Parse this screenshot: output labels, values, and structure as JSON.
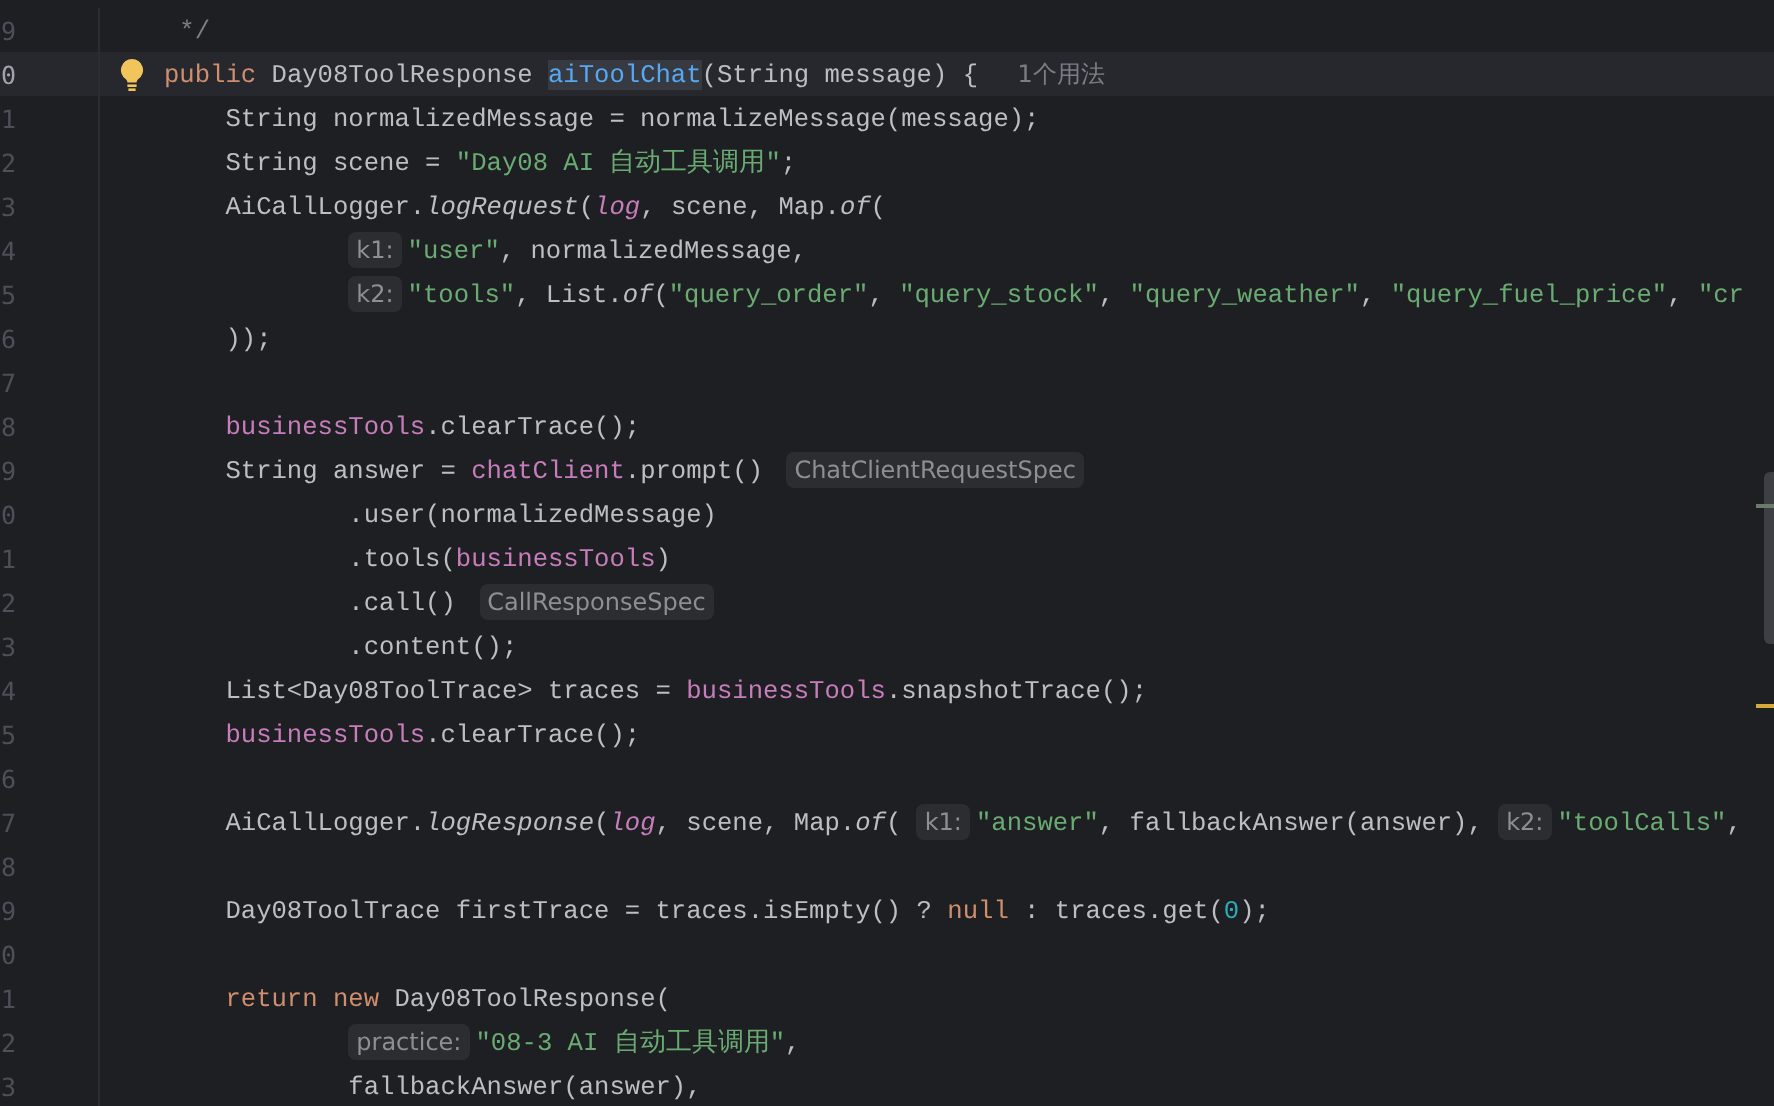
{
  "editor": {
    "lines": [
      {
        "number": "9",
        "current": false,
        "kind": "comment",
        "segments": [
          {
            "kind": "code",
            "tokens": [
              {
                "kind": "comment",
                "text": "*/"
              }
            ]
          }
        ]
      },
      {
        "number": "0",
        "current": true,
        "kind": "top",
        "segments": [
          {
            "kind": "code",
            "tokens": [
              {
                "kind": "kw",
                "text": "public "
              },
              {
                "kind": "plain",
                "text": "Day08ToolResponse "
              },
              {
                "kind": "decl",
                "text": "aiToolChat"
              },
              {
                "kind": "plain",
                "text": "(String message) {"
              }
            ]
          },
          {
            "kind": "usage",
            "text": "1个用法"
          }
        ]
      },
      {
        "number": "1",
        "current": false,
        "kind": "body",
        "segments": [
          {
            "kind": "code",
            "tokens": [
              {
                "kind": "plain",
                "text": "String normalizedMessage = normalizeMessage(message);"
              }
            ]
          }
        ]
      },
      {
        "number": "2",
        "current": false,
        "kind": "body",
        "segments": [
          {
            "kind": "code",
            "tokens": [
              {
                "kind": "plain",
                "text": "String scene = "
              },
              {
                "kind": "str",
                "text": "\"Day08 AI 自动工具调用\""
              },
              {
                "kind": "plain",
                "text": ";"
              }
            ]
          }
        ]
      },
      {
        "number": "3",
        "current": false,
        "kind": "body",
        "segments": [
          {
            "kind": "code",
            "tokens": [
              {
                "kind": "plain",
                "text": "AiCallLogger."
              },
              {
                "kind": "static",
                "text": "logRequest"
              },
              {
                "kind": "plain",
                "text": "("
              },
              {
                "kind": "static_field",
                "text": "log"
              },
              {
                "kind": "plain",
                "text": ", scene, Map."
              },
              {
                "kind": "static",
                "text": "of"
              },
              {
                "kind": "plain",
                "text": "("
              }
            ]
          }
        ]
      },
      {
        "number": "4",
        "current": false,
        "kind": "continuation",
        "segments": [
          {
            "kind": "hint",
            "text": "k1:"
          },
          {
            "kind": "code",
            "tokens": [
              {
                "kind": "str",
                "text": "\"user\""
              },
              {
                "kind": "plain",
                "text": ", normalizedMessage,"
              }
            ]
          }
        ]
      },
      {
        "number": "5",
        "current": false,
        "kind": "continuation",
        "segments": [
          {
            "kind": "hint",
            "text": "k2:"
          },
          {
            "kind": "code",
            "tokens": [
              {
                "kind": "str",
                "text": "\"tools\""
              },
              {
                "kind": "plain",
                "text": ", List."
              },
              {
                "kind": "static",
                "text": "of"
              },
              {
                "kind": "plain",
                "text": "("
              },
              {
                "kind": "str",
                "text": "\"query_order\""
              },
              {
                "kind": "plain",
                "text": ", "
              },
              {
                "kind": "str",
                "text": "\"query_stock\""
              },
              {
                "kind": "plain",
                "text": ", "
              },
              {
                "kind": "str",
                "text": "\"query_weather\""
              },
              {
                "kind": "plain",
                "text": ", "
              },
              {
                "kind": "str",
                "text": "\"query_fuel_price\""
              },
              {
                "kind": "plain",
                "text": ", "
              },
              {
                "kind": "str",
                "text": "\"cr"
              }
            ]
          }
        ]
      },
      {
        "number": "6",
        "current": false,
        "kind": "body",
        "segments": [
          {
            "kind": "code",
            "tokens": [
              {
                "kind": "plain",
                "text": "));"
              }
            ]
          }
        ]
      },
      {
        "number": "7",
        "current": false,
        "kind": "body"
      },
      {
        "number": "8",
        "current": false,
        "kind": "body",
        "segments": [
          {
            "kind": "code",
            "tokens": [
              {
                "kind": "field",
                "text": "businessTools"
              },
              {
                "kind": "plain",
                "text": ".clearTrace();"
              }
            ]
          }
        ]
      },
      {
        "number": "9",
        "current": false,
        "kind": "body",
        "segments": [
          {
            "kind": "code",
            "tokens": [
              {
                "kind": "plain",
                "text": "String answer = "
              },
              {
                "kind": "field",
                "text": "chatClient"
              },
              {
                "kind": "plain",
                "text": ".prompt()"
              }
            ]
          },
          {
            "kind": "type_hint",
            "text": "ChatClientRequestSpec"
          }
        ]
      },
      {
        "number": "0",
        "current": false,
        "kind": "continuation",
        "segments": [
          {
            "kind": "code",
            "tokens": [
              {
                "kind": "plain",
                "text": ".user(normalizedMessage)"
              }
            ]
          }
        ]
      },
      {
        "number": "1",
        "current": false,
        "kind": "continuation",
        "segments": [
          {
            "kind": "code",
            "tokens": [
              {
                "kind": "plain",
                "text": ".tools("
              },
              {
                "kind": "field",
                "text": "businessTools"
              },
              {
                "kind": "plain",
                "text": ")"
              }
            ]
          }
        ]
      },
      {
        "number": "2",
        "current": false,
        "kind": "continuation",
        "segments": [
          {
            "kind": "code",
            "tokens": [
              {
                "kind": "plain",
                "text": ".call()"
              }
            ]
          },
          {
            "kind": "type_hint",
            "text": "CallResponseSpec"
          }
        ]
      },
      {
        "number": "3",
        "current": false,
        "kind": "continuation",
        "segments": [
          {
            "kind": "code",
            "tokens": [
              {
                "kind": "plain",
                "text": ".content();"
              }
            ]
          }
        ]
      },
      {
        "number": "4",
        "current": false,
        "kind": "body",
        "segments": [
          {
            "kind": "code",
            "tokens": [
              {
                "kind": "plain",
                "text": "List<Day08ToolTrace> traces = "
              },
              {
                "kind": "field",
                "text": "businessTools"
              },
              {
                "kind": "plain",
                "text": ".snapshotTrace();"
              }
            ]
          }
        ]
      },
      {
        "number": "5",
        "current": false,
        "kind": "body",
        "segments": [
          {
            "kind": "code",
            "tokens": [
              {
                "kind": "field",
                "text": "businessTools"
              },
              {
                "kind": "plain",
                "text": ".clearTrace();"
              }
            ]
          }
        ]
      },
      {
        "number": "6",
        "current": false,
        "kind": "body"
      },
      {
        "number": "7",
        "current": false,
        "kind": "body",
        "segments": [
          {
            "kind": "code",
            "tokens": [
              {
                "kind": "plain",
                "text": "AiCallLogger."
              },
              {
                "kind": "static",
                "text": "logResponse"
              },
              {
                "kind": "plain",
                "text": "("
              },
              {
                "kind": "static_field",
                "text": "log"
              },
              {
                "kind": "plain",
                "text": ", scene, Map."
              },
              {
                "kind": "static",
                "text": "of"
              },
              {
                "kind": "plain",
                "text": "("
              }
            ]
          },
          {
            "kind": "hint",
            "text": "k1:"
          },
          {
            "kind": "code",
            "tokens": [
              {
                "kind": "str",
                "text": "\"answer\""
              },
              {
                "kind": "plain",
                "text": ", fallbackAnswer(answer),"
              }
            ]
          },
          {
            "kind": "hint",
            "text": "k2:"
          },
          {
            "kind": "code",
            "tokens": [
              {
                "kind": "str",
                "text": "\"toolCalls\""
              },
              {
                "kind": "plain",
                "text": ","
              }
            ]
          }
        ]
      },
      {
        "number": "8",
        "current": false,
        "kind": "body"
      },
      {
        "number": "9",
        "current": false,
        "kind": "body",
        "segments": [
          {
            "kind": "code",
            "tokens": [
              {
                "kind": "plain",
                "text": "Day08ToolTrace firstTrace = traces.isEmpty() ? "
              },
              {
                "kind": "kw",
                "text": "null"
              },
              {
                "kind": "plain",
                "text": " : traces.get("
              },
              {
                "kind": "num",
                "text": "0"
              },
              {
                "kind": "plain",
                "text": ");"
              }
            ]
          }
        ]
      },
      {
        "number": "0",
        "current": false,
        "kind": "body"
      },
      {
        "number": "1",
        "current": false,
        "kind": "body",
        "segments": [
          {
            "kind": "code",
            "tokens": [
              {
                "kind": "kw",
                "text": "return new "
              },
              {
                "kind": "plain",
                "text": "Day08ToolResponse("
              }
            ]
          }
        ]
      },
      {
        "number": "2",
        "current": false,
        "kind": "continuation",
        "segments": [
          {
            "kind": "hint",
            "text": "practice:"
          },
          {
            "kind": "code",
            "tokens": [
              {
                "kind": "str",
                "text": "\"08-3 AI 自动工具调用\""
              },
              {
                "kind": "plain",
                "text": ","
              }
            ]
          }
        ]
      },
      {
        "number": "3",
        "current": false,
        "kind": "continuation",
        "segments": [
          {
            "kind": "code",
            "tokens": [
              {
                "kind": "plain",
                "text": "fallbackAnswer(answer),"
              }
            ]
          }
        ]
      }
    ]
  }
}
